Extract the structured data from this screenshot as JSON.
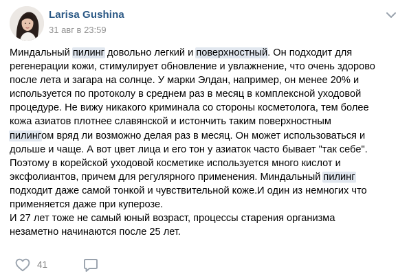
{
  "post": {
    "author": "Larisa Gushina",
    "date": "31 авг в 23:59",
    "lines": [
      [
        {
          "t": "Миндальный "
        },
        {
          "t": "пилинг",
          "hl": true
        },
        {
          "t": " довольно легкий и "
        },
        {
          "t": "поверхностный",
          "hl": true
        },
        {
          "t": ". Он подходит для"
        }
      ],
      [
        {
          "t": "регенерации кожи, стимулирует обновление и увлажнение, что очень здорово"
        }
      ],
      [
        {
          "t": "после лета и загара на солнце. У марки Элдан, например, он менее 20% и"
        }
      ],
      [
        {
          "t": "используется по протоколу в среднем раз в месяц в комплексной уходовой"
        }
      ],
      [
        {
          "t": "процедуре. Не вижу никакого криминала со стороны косметолога, тем более"
        }
      ],
      [
        {
          "t": "кожа азиатов плотнее славянской и истончить таким поверхностным"
        }
      ],
      [
        {
          "t": "пилинг",
          "hl": true
        },
        {
          "t": "ом вряд ли возможно делая раз в месяц. Он может использоваться и"
        }
      ],
      [
        {
          "t": "дольше и чаще. А вот цвет лица и его тон у азиаток часто бывает \"так себе\"."
        }
      ],
      [
        {
          "t": "Поэтому в корейской уходовой косметике используется много кислот и"
        }
      ],
      [
        {
          "t": "эксфолиантов, причем для регулярного применения. Миндальный "
        },
        {
          "t": "пилинг",
          "hl": true
        }
      ],
      [
        {
          "t": "подходит даже самой тонкой и чувствительной коже.И один из немногих что"
        }
      ],
      [
        {
          "t": "применяется даже при куперозе."
        }
      ],
      [
        {
          "t": "И 27 лет тоже не самый юный возраст, процессы старения организма"
        }
      ],
      [
        {
          "t": "незаметно начинаются после 25 лет."
        }
      ]
    ]
  },
  "actions": {
    "like_count": "41",
    "like_icon": "heart-icon",
    "comment_icon": "comment-icon"
  },
  "colors": {
    "author": "#2a5885",
    "muted": "#939393",
    "highlight": "#e1e7ef",
    "icon": "#99a2ad"
  }
}
